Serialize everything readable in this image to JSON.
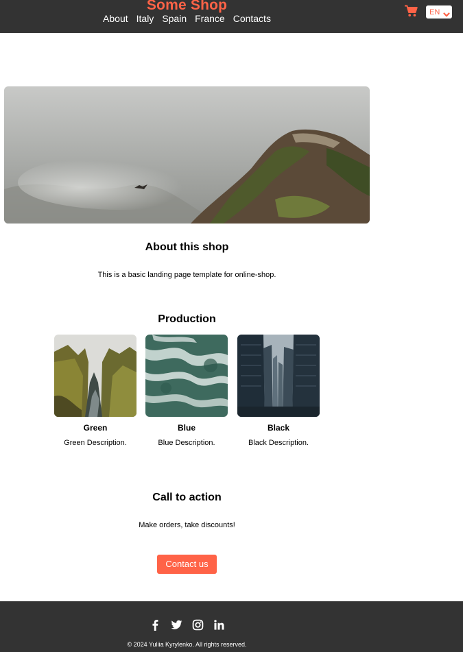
{
  "header": {
    "logo": "Some Shop",
    "nav": [
      "About",
      "Italy",
      "Spain",
      "France",
      "Contacts"
    ],
    "cart_icon": "shopping-cart-icon",
    "language": "EN"
  },
  "hero": {
    "image": "foggy-mountain-photo"
  },
  "about": {
    "title": "About this shop",
    "text": "This is a basic landing page template for online-shop."
  },
  "production": {
    "title": "Production",
    "items": [
      {
        "name": "Green",
        "description": "Green Description.",
        "image": "mossy-canyon-photo"
      },
      {
        "name": "Blue",
        "description": "Blue Description.",
        "image": "ocean-waves-photo"
      },
      {
        "name": "Black",
        "description": "Black Description.",
        "image": "city-buildings-photo"
      }
    ]
  },
  "cta": {
    "title": "Call to action",
    "text": "Make orders, take discounts!",
    "button": "Contact us"
  },
  "footer": {
    "socials": [
      "facebook-icon",
      "twitter-icon",
      "instagram-icon",
      "linkedin-icon"
    ],
    "copyright": "© 2024 Yuliia Kyrylenko. All rights reserved."
  },
  "colors": {
    "accent": "#ff6347",
    "header_bg": "#333333",
    "footer_bg": "#333333"
  }
}
